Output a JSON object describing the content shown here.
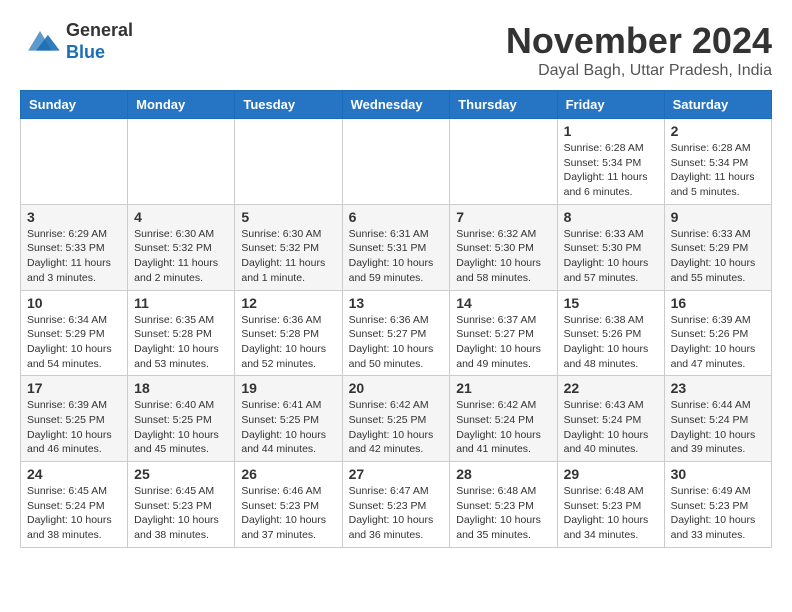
{
  "logo": {
    "general": "General",
    "blue": "Blue"
  },
  "title": {
    "month_year": "November 2024",
    "location": "Dayal Bagh, Uttar Pradesh, India"
  },
  "headers": [
    "Sunday",
    "Monday",
    "Tuesday",
    "Wednesday",
    "Thursday",
    "Friday",
    "Saturday"
  ],
  "weeks": [
    [
      {
        "day": "",
        "info": ""
      },
      {
        "day": "",
        "info": ""
      },
      {
        "day": "",
        "info": ""
      },
      {
        "day": "",
        "info": ""
      },
      {
        "day": "",
        "info": ""
      },
      {
        "day": "1",
        "info": "Sunrise: 6:28 AM\nSunset: 5:34 PM\nDaylight: 11 hours and 6 minutes."
      },
      {
        "day": "2",
        "info": "Sunrise: 6:28 AM\nSunset: 5:34 PM\nDaylight: 11 hours and 5 minutes."
      }
    ],
    [
      {
        "day": "3",
        "info": "Sunrise: 6:29 AM\nSunset: 5:33 PM\nDaylight: 11 hours and 3 minutes."
      },
      {
        "day": "4",
        "info": "Sunrise: 6:30 AM\nSunset: 5:32 PM\nDaylight: 11 hours and 2 minutes."
      },
      {
        "day": "5",
        "info": "Sunrise: 6:30 AM\nSunset: 5:32 PM\nDaylight: 11 hours and 1 minute."
      },
      {
        "day": "6",
        "info": "Sunrise: 6:31 AM\nSunset: 5:31 PM\nDaylight: 10 hours and 59 minutes."
      },
      {
        "day": "7",
        "info": "Sunrise: 6:32 AM\nSunset: 5:30 PM\nDaylight: 10 hours and 58 minutes."
      },
      {
        "day": "8",
        "info": "Sunrise: 6:33 AM\nSunset: 5:30 PM\nDaylight: 10 hours and 57 minutes."
      },
      {
        "day": "9",
        "info": "Sunrise: 6:33 AM\nSunset: 5:29 PM\nDaylight: 10 hours and 55 minutes."
      }
    ],
    [
      {
        "day": "10",
        "info": "Sunrise: 6:34 AM\nSunset: 5:29 PM\nDaylight: 10 hours and 54 minutes."
      },
      {
        "day": "11",
        "info": "Sunrise: 6:35 AM\nSunset: 5:28 PM\nDaylight: 10 hours and 53 minutes."
      },
      {
        "day": "12",
        "info": "Sunrise: 6:36 AM\nSunset: 5:28 PM\nDaylight: 10 hours and 52 minutes."
      },
      {
        "day": "13",
        "info": "Sunrise: 6:36 AM\nSunset: 5:27 PM\nDaylight: 10 hours and 50 minutes."
      },
      {
        "day": "14",
        "info": "Sunrise: 6:37 AM\nSunset: 5:27 PM\nDaylight: 10 hours and 49 minutes."
      },
      {
        "day": "15",
        "info": "Sunrise: 6:38 AM\nSunset: 5:26 PM\nDaylight: 10 hours and 48 minutes."
      },
      {
        "day": "16",
        "info": "Sunrise: 6:39 AM\nSunset: 5:26 PM\nDaylight: 10 hours and 47 minutes."
      }
    ],
    [
      {
        "day": "17",
        "info": "Sunrise: 6:39 AM\nSunset: 5:25 PM\nDaylight: 10 hours and 46 minutes."
      },
      {
        "day": "18",
        "info": "Sunrise: 6:40 AM\nSunset: 5:25 PM\nDaylight: 10 hours and 45 minutes."
      },
      {
        "day": "19",
        "info": "Sunrise: 6:41 AM\nSunset: 5:25 PM\nDaylight: 10 hours and 44 minutes."
      },
      {
        "day": "20",
        "info": "Sunrise: 6:42 AM\nSunset: 5:25 PM\nDaylight: 10 hours and 42 minutes."
      },
      {
        "day": "21",
        "info": "Sunrise: 6:42 AM\nSunset: 5:24 PM\nDaylight: 10 hours and 41 minutes."
      },
      {
        "day": "22",
        "info": "Sunrise: 6:43 AM\nSunset: 5:24 PM\nDaylight: 10 hours and 40 minutes."
      },
      {
        "day": "23",
        "info": "Sunrise: 6:44 AM\nSunset: 5:24 PM\nDaylight: 10 hours and 39 minutes."
      }
    ],
    [
      {
        "day": "24",
        "info": "Sunrise: 6:45 AM\nSunset: 5:24 PM\nDaylight: 10 hours and 38 minutes."
      },
      {
        "day": "25",
        "info": "Sunrise: 6:45 AM\nSunset: 5:23 PM\nDaylight: 10 hours and 38 minutes."
      },
      {
        "day": "26",
        "info": "Sunrise: 6:46 AM\nSunset: 5:23 PM\nDaylight: 10 hours and 37 minutes."
      },
      {
        "day": "27",
        "info": "Sunrise: 6:47 AM\nSunset: 5:23 PM\nDaylight: 10 hours and 36 minutes."
      },
      {
        "day": "28",
        "info": "Sunrise: 6:48 AM\nSunset: 5:23 PM\nDaylight: 10 hours and 35 minutes."
      },
      {
        "day": "29",
        "info": "Sunrise: 6:48 AM\nSunset: 5:23 PM\nDaylight: 10 hours and 34 minutes."
      },
      {
        "day": "30",
        "info": "Sunrise: 6:49 AM\nSunset: 5:23 PM\nDaylight: 10 hours and 33 minutes."
      }
    ]
  ]
}
